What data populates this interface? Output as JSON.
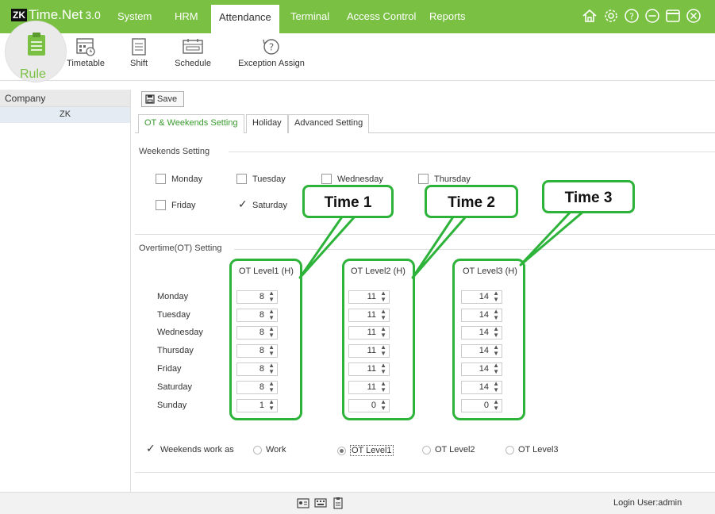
{
  "app": {
    "title": "Time.Net",
    "version": "3.0",
    "logo_mark": "ZK"
  },
  "menu": [
    {
      "label": "System"
    },
    {
      "label": "HRM"
    },
    {
      "label": "Attendance"
    },
    {
      "label": "Terminal"
    },
    {
      "label": "Access Control"
    },
    {
      "label": "Reports"
    }
  ],
  "toolbar": {
    "items": [
      {
        "label": "Rule"
      },
      {
        "label": "Timetable"
      },
      {
        "label": "Shift"
      },
      {
        "label": "Schedule"
      },
      {
        "label": "Exception Assign"
      }
    ]
  },
  "left_panel": {
    "header": "Company",
    "row": "ZK"
  },
  "save_label": "Save",
  "tabs": [
    {
      "label": "OT & Weekends Setting"
    },
    {
      "label": "Holiday"
    },
    {
      "label": "Advanced Setting"
    }
  ],
  "weekends": {
    "title": "Weekends Setting",
    "days": [
      {
        "label": "Monday",
        "checked": false
      },
      {
        "label": "Tuesday",
        "checked": false
      },
      {
        "label": "Wednesday",
        "checked": false
      },
      {
        "label": "Thursday",
        "checked": false
      },
      {
        "label": "Friday",
        "checked": false
      },
      {
        "label": "Saturday",
        "checked": true
      }
    ]
  },
  "ot": {
    "title": "Overtime(OT) Setting",
    "columns": [
      "OT Level1 (H)",
      "OT Level2 (H)",
      "OT Level3 (H)"
    ],
    "days": [
      "Monday",
      "Tuesday",
      "Wednesday",
      "Thursday",
      "Friday",
      "Saturday",
      "Sunday"
    ],
    "level1": [
      "8",
      "8",
      "8",
      "8",
      "8",
      "8",
      "1"
    ],
    "level2": [
      "11",
      "11",
      "11",
      "11",
      "11",
      "11",
      "0"
    ],
    "level3": [
      "14",
      "14",
      "14",
      "14",
      "14",
      "14",
      "0"
    ]
  },
  "weekends_work": {
    "label": "Weekends work as",
    "checked": true,
    "options": [
      {
        "label": "Work",
        "selected": false
      },
      {
        "label": "OT Level1",
        "selected": true
      },
      {
        "label": "OT Level2",
        "selected": false
      },
      {
        "label": "OT Level3",
        "selected": false
      }
    ]
  },
  "callouts": [
    "Time 1",
    "Time 2",
    "Time 3"
  ],
  "status": {
    "login": "Login User:admin"
  },
  "colors": {
    "accent": "#7ac143",
    "callout": "#2db33a"
  }
}
